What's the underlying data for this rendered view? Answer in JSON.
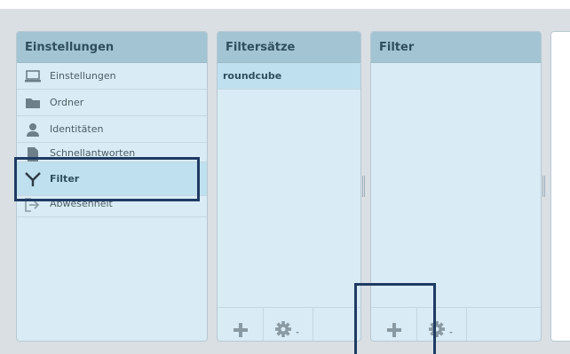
{
  "panels": {
    "settings": {
      "title": "Einstellungen",
      "items": [
        {
          "label": "Einstellungen",
          "icon": "laptop-icon"
        },
        {
          "label": "Ordner",
          "icon": "folder-icon"
        },
        {
          "label": "Identitäten",
          "icon": "user-icon"
        },
        {
          "label": "Schnellantworten",
          "icon": "document-icon"
        },
        {
          "label": "Filter",
          "icon": "filter-icon"
        },
        {
          "label": "Abwesenheit",
          "icon": "out-of-office-icon"
        }
      ]
    },
    "filtersets": {
      "title": "Filtersätze",
      "items": [
        {
          "label": "roundcube"
        }
      ]
    },
    "filters": {
      "title": "Filter"
    }
  },
  "colors": {
    "background": "#d9dfe3",
    "panel": "#d9ebf4",
    "header": "#a3c4d3",
    "selected": "#bfe0ee",
    "highlight": "#1f3b63",
    "icon": "#8a9aa3"
  }
}
